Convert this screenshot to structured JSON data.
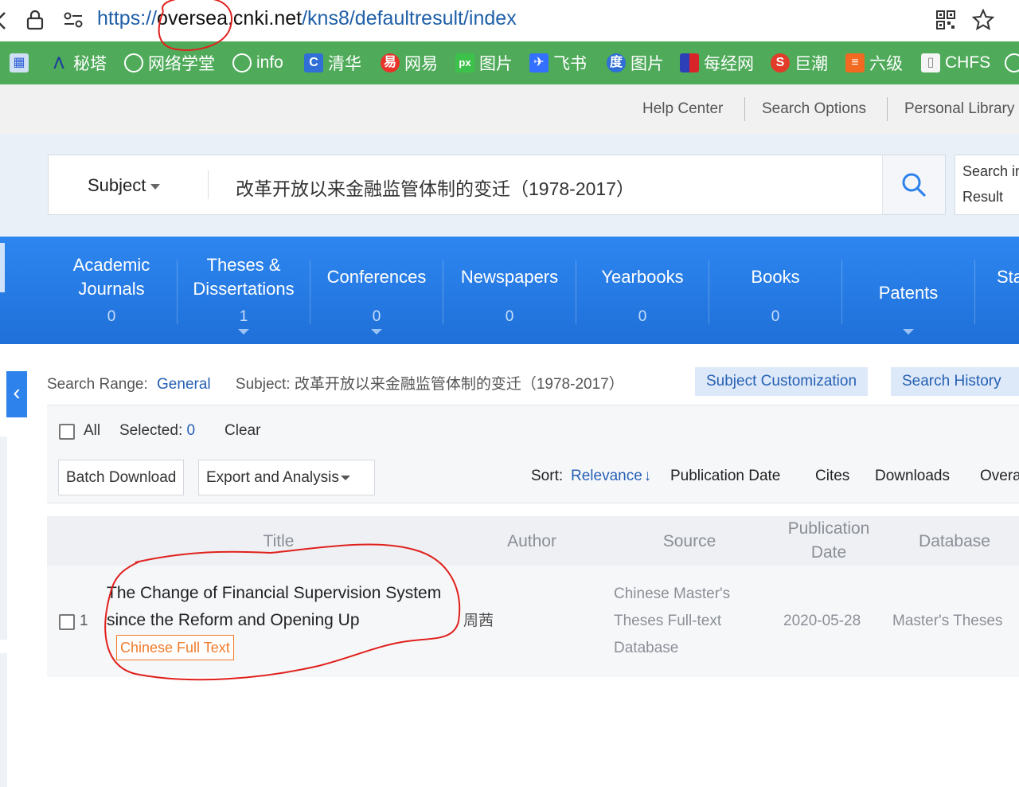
{
  "browser": {
    "url_prefix": "https://",
    "url_domain": "oversea.cnki.net",
    "url_path": "/kns8/defaultresult/index"
  },
  "bookmarks": [
    {
      "label": "秘塔",
      "icon": "ai-icon",
      "color": "#2b5bd6"
    },
    {
      "label": "网络学堂",
      "icon": "globe-icon",
      "color": "#ffffff"
    },
    {
      "label": "info",
      "icon": "globe-icon",
      "color": "#ffffff"
    },
    {
      "label": "清华",
      "icon": "c-icon",
      "color": "#2f6fd6"
    },
    {
      "label": "网易",
      "icon": "netease-icon",
      "color": "#e8332b"
    },
    {
      "label": "图片",
      "icon": "px-icon",
      "color": "#3cc24a"
    },
    {
      "label": "飞书",
      "icon": "feishu-icon",
      "color": "#3370ff"
    },
    {
      "label": "图片",
      "icon": "baidu-icon",
      "color": "#2f6fd6"
    },
    {
      "label": "每经网",
      "icon": "nbd-icon",
      "color": "#d9252a"
    },
    {
      "label": "巨潮",
      "icon": "juchao-icon",
      "color": "#e23b2a"
    },
    {
      "label": "六级",
      "icon": "list-icon",
      "color": "#f26a21"
    },
    {
      "label": "CHFS",
      "icon": "doc-icon",
      "color": "#ffffff"
    }
  ],
  "toplinks": [
    "Help Center",
    "Search Options",
    "Personal Library"
  ],
  "search": {
    "field": "Subject",
    "query": "改革开放以来金融监管体制的变迁（1978-2017）",
    "result_button_line1": "Search in",
    "result_button_line2": "Result"
  },
  "tabs": [
    {
      "name": "Academic Journals",
      "count": "0"
    },
    {
      "name": "Theses & Dissertations",
      "count": "1"
    },
    {
      "name": "Conferences",
      "count": "0"
    },
    {
      "name": "Newspapers",
      "count": "0"
    },
    {
      "name": "Yearbooks",
      "count": "0"
    },
    {
      "name": "Books",
      "count": "0"
    },
    {
      "name": "Patents",
      "count": ""
    },
    {
      "name": "Sta",
      "count": ""
    }
  ],
  "filter": {
    "range_label": "Search Range:",
    "range_value": "General",
    "subject_label": "Subject:",
    "subject_value": "改革开放以来金融监管体制的变迁（1978-2017）",
    "customize": "Subject Customization",
    "history": "Search History"
  },
  "toolbar": {
    "all": "All",
    "selected_label": "Selected:",
    "selected_count": "0",
    "clear": "Clear",
    "batch_download": "Batch Download",
    "export": "Export and Analysis",
    "sort_label": "Sort:",
    "sort_options": [
      "Relevance",
      "Publication Date",
      "Cites",
      "Downloads",
      "Overa"
    ]
  },
  "table": {
    "headers": {
      "title": "Title",
      "author": "Author",
      "source": "Source",
      "pubdate": "Publication Date",
      "database": "Database"
    },
    "rows": [
      {
        "index": "1",
        "title": "The Change of Financial Supervision System since the Reform and Opening Up",
        "fulltext": "Chinese Full Text",
        "author": "周茜",
        "source": "Chinese Master's Theses Full-text Database",
        "pubdate": "2020-05-28",
        "database": "Master's Theses"
      }
    ]
  },
  "colors": {
    "bookmark_bar": "#4fab5a",
    "tab_bar": "#2e86f0",
    "link_blue": "#2660b5",
    "fulltext_orange": "#f07b2b",
    "annotation_red": "#e0201c"
  }
}
